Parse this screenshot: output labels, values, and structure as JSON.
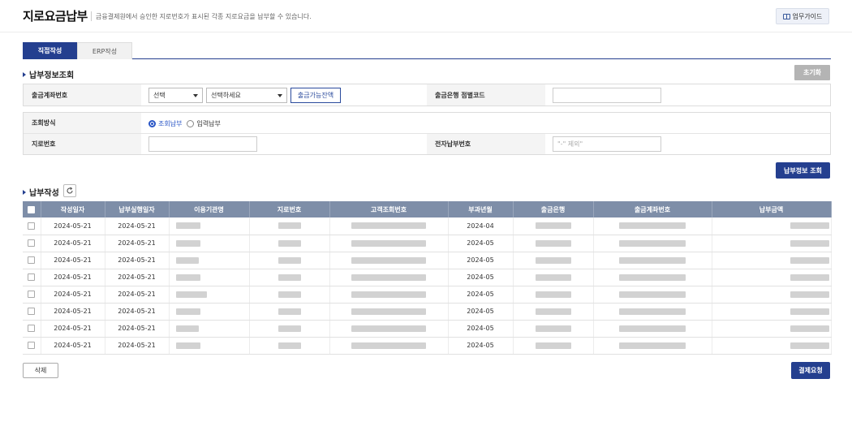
{
  "header": {
    "title": "지로요금납부",
    "subtitle": "금융결제원에서 승인한 지로번호가 표시된 각종 지로요금을 납부할 수 있습니다.",
    "guide_button": "업무가이드"
  },
  "tabs": [
    {
      "label": "직접작성",
      "active": true
    },
    {
      "label": "ERP작성",
      "active": false
    }
  ],
  "inquiry": {
    "section_title": "납부정보조회",
    "reset_button": "초기화",
    "account_label": "출금계좌번호",
    "account_select_1": "선택",
    "account_select_2": "선택하세요",
    "balance_button": "출금가능잔액",
    "bank_code_label": "출금은행 점별코드",
    "bank_code_value": "",
    "method_label": "조회방식",
    "method_options": [
      {
        "label": "조회납부",
        "checked": true
      },
      {
        "label": "입력납부",
        "checked": false
      }
    ],
    "giro_label": "지로번호",
    "giro_value": "",
    "epay_label": "전자납부번호",
    "epay_placeholder": "\"-\" 제외\"",
    "search_button": "납부정보 조회"
  },
  "payment": {
    "section_title": "납부작성",
    "columns": [
      "작성일자",
      "납부실행일자",
      "이용기관명",
      "지로번호",
      "고객조회번호",
      "부과년월",
      "출금은행",
      "출금계좌번호",
      "납부금액"
    ],
    "rows": [
      {
        "created": "2024-05-21",
        "exec": "2024-05-21",
        "period": "2024-04"
      },
      {
        "created": "2024-05-21",
        "exec": "2024-05-21",
        "period": "2024-05"
      },
      {
        "created": "2024-05-21",
        "exec": "2024-05-21",
        "period": "2024-05"
      },
      {
        "created": "2024-05-21",
        "exec": "2024-05-21",
        "period": "2024-05"
      },
      {
        "created": "2024-05-21",
        "exec": "2024-05-21",
        "period": "2024-05"
      },
      {
        "created": "2024-05-21",
        "exec": "2024-05-21",
        "period": "2024-05"
      },
      {
        "created": "2024-05-21",
        "exec": "2024-05-21",
        "period": "2024-05"
      },
      {
        "created": "2024-05-21",
        "exec": "2024-05-21",
        "period": "2024-05"
      }
    ],
    "delete_button": "삭제",
    "pay_button": "결제요청"
  },
  "colors": {
    "navy": "#243f8f",
    "table_header": "#7e8ea8"
  }
}
